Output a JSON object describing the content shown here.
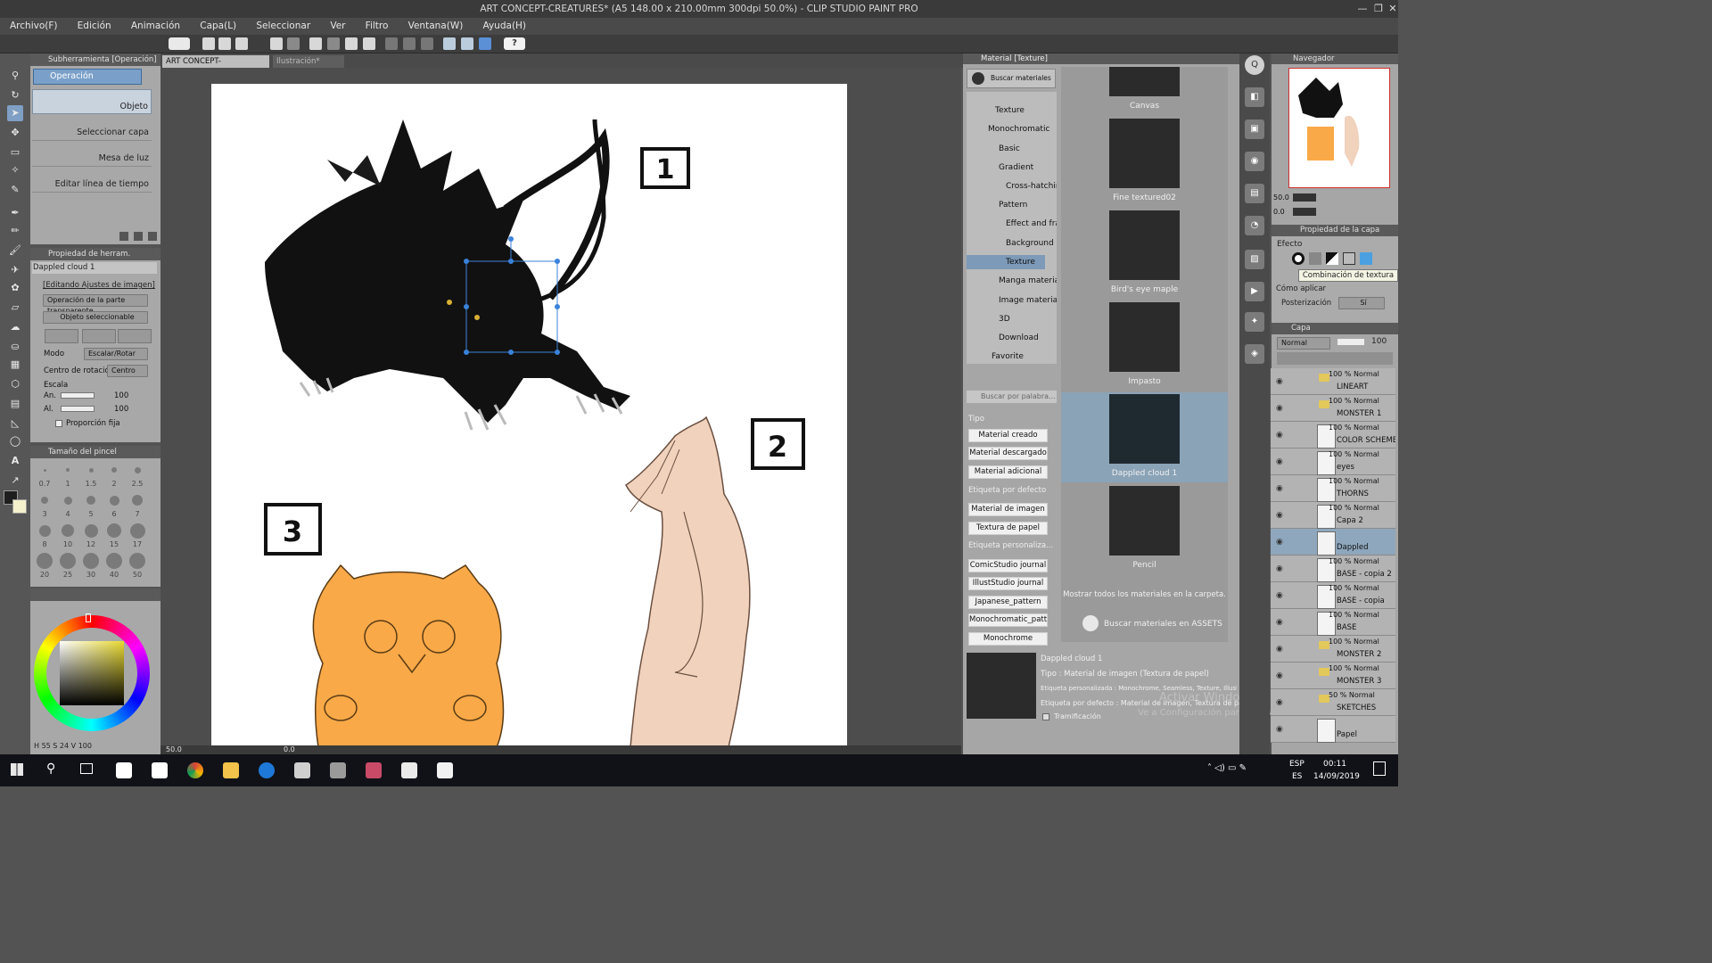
{
  "window": {
    "title": "ART CONCEPT-CREATURES* (A5 148.00 x 210.00mm 300dpi 50.0%) - CLIP STUDIO PAINT PRO"
  },
  "menu": [
    "Archivo(F)",
    "Edición",
    "Animación",
    "Capa(L)",
    "Seleccionar",
    "Ver",
    "Filtro",
    "Ventana(W)",
    "Ayuda(H)"
  ],
  "subtool": {
    "header": "Subherramienta [Operación]",
    "tab": "Operación",
    "items": [
      "Objeto",
      "Seleccionar capa",
      "Mesa de luz",
      "Editar línea de tiempo"
    ]
  },
  "toolprop": {
    "header": "Propiedad de herram. [Objeto]",
    "material_name": "Dappled cloud 1",
    "editing_label": "[Editando Ajustes de imagen]",
    "transparent_op": "Operación de la parte transparente",
    "selectable": "Objeto seleccionable",
    "mode_label": "Modo",
    "mode_value": "Escalar/Rotar",
    "rotation_label": "Centro de rotación",
    "rotation_value": "Centro",
    "scale_label": "Escala",
    "width_label": "An.",
    "width_value": "100",
    "height_label": "Al.",
    "height_value": "100",
    "keep_ratio": "Proporción fija"
  },
  "brushsize": {
    "header": "Tamaño del pincel",
    "sizes": [
      "0.7",
      "1",
      "1.5",
      "2",
      "2.5",
      "3",
      "4",
      "5",
      "6",
      "7",
      "8",
      "10",
      "12",
      "15",
      "17",
      "20",
      "25",
      "30",
      "40",
      "50"
    ]
  },
  "color": {
    "h": "55",
    "s": "24",
    "v": "100",
    "h_label": "H",
    "s_label": "S",
    "v_label": "V"
  },
  "tabs": [
    {
      "label": "ART CONCEPT-CREATURES*"
    },
    {
      "label": "Ilustración*"
    }
  ],
  "canvas": {
    "zoom": "50.0",
    "angle": "0.0",
    "labels": [
      "1",
      "2",
      "3"
    ]
  },
  "material": {
    "header": "Material [Texture]",
    "search_assets_btn": "Buscar materiales en ASSETS",
    "tree": [
      {
        "label": "Texture",
        "indent": 2
      },
      {
        "label": "Monochromatic",
        "indent": 1
      },
      {
        "label": "Basic",
        "indent": 2
      },
      {
        "label": "Gradient",
        "indent": 2
      },
      {
        "label": "Cross-hatching",
        "indent": 2
      },
      {
        "label": "Pattern",
        "indent": 2
      },
      {
        "label": "Effect and frame",
        "indent": 2
      },
      {
        "label": "Background",
        "indent": 2
      },
      {
        "label": "Texture",
        "indent": 2
      },
      {
        "label": "Manga material",
        "indent": 1
      },
      {
        "label": "Image material",
        "indent": 1
      },
      {
        "label": "3D",
        "indent": 1
      },
      {
        "label": "Download",
        "indent": 1
      },
      {
        "label": "Favorite",
        "indent": 0
      }
    ],
    "search_placeholder": "Buscar por palabra...",
    "type_label": "Tipo",
    "type_tags": [
      "Material creado",
      "Material descargado",
      "Material adicional"
    ],
    "default_label": "Etiqueta por defecto",
    "default_tags": [
      "Material de imagen",
      "Textura de papel"
    ],
    "custom_label": "Etiqueta personaliza...",
    "custom_tags": [
      "ComicStudio journal",
      "IllustStudio journal",
      "Japanese_pattern",
      "Monochromatic_pattern",
      "Monochrome"
    ],
    "swatches": [
      "Canvas",
      "Fine textured02",
      "Bird's eye maple",
      "Impasto",
      "Dappled cloud 1",
      "Pencil"
    ],
    "show_all": "Mostrar todos los materiales en la carpeta.",
    "assets_link": "Buscar materiales en ASSETS",
    "detail_name": "Dappled cloud 1",
    "detail_type": "Tipo : Material de imagen (Textura de papel)",
    "detail_custom": "Etiqueta personalizada : Monochrome, Seamless, Texture, IllustStudio journal",
    "detail_default": "Etiqueta por defecto : Material de imagen, Textura de papel",
    "tiling": "Tramificación"
  },
  "watermark": {
    "line1": "Activar Windows",
    "line2": "Ve a Configuración para activar Windows."
  },
  "navigator": {
    "header": "Navegador",
    "zoom": "50.0",
    "angle": "0.0"
  },
  "layerprop": {
    "header": "Propiedad de la capa",
    "effect_label": "Efecto",
    "tooltip": "Combinación de textura",
    "apply_label": "Cómo aplicar",
    "posterize_label": "Posterización",
    "posterize_value": "Sí"
  },
  "layers": {
    "header": "Capa",
    "blend": "Normal",
    "opacity": "100",
    "rows": [
      {
        "pct": "100 % Normal",
        "name": "LINEART",
        "folder": true
      },
      {
        "pct": "100 % Normal",
        "name": "MONSTER 1",
        "folder": true
      },
      {
        "pct": "100 % Normal",
        "name": "COLOR SCHEME",
        "folder": false
      },
      {
        "pct": "100 % Normal",
        "name": "eyes",
        "folder": false
      },
      {
        "pct": "100 % Normal",
        "name": "THORNS",
        "folder": false
      },
      {
        "pct": "100 % Normal",
        "name": "Capa 2",
        "folder": false
      },
      {
        "pct": "",
        "name": "Dappled",
        "folder": false
      },
      {
        "pct": "100 % Normal",
        "name": "BASE - copia 2",
        "folder": false
      },
      {
        "pct": "100 % Normal",
        "name": "BASE - copia",
        "folder": false
      },
      {
        "pct": "100 % Normal",
        "name": "BASE",
        "folder": false
      },
      {
        "pct": "100 % Normal",
        "name": "MONSTER 2",
        "folder": true
      },
      {
        "pct": "100 % Normal",
        "name": "MONSTER 3",
        "folder": true
      },
      {
        "pct": "50 % Normal",
        "name": "SKETCHES",
        "folder": true
      },
      {
        "pct": "",
        "name": "Papel",
        "folder": false
      }
    ]
  },
  "taskbar": {
    "lang1": "ESP",
    "lang2": "ES",
    "time": "00:11",
    "date": "14/09/2019"
  }
}
